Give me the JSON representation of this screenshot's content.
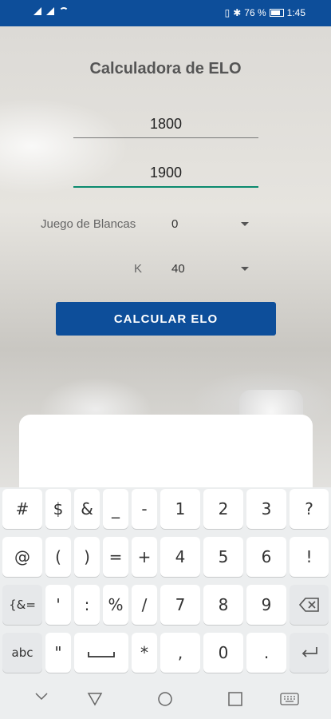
{
  "status_bar": {
    "battery_percent": "76 %",
    "time": "1:45"
  },
  "app": {
    "title": "Calculadora de ELO",
    "rating1": "1800",
    "rating2": "1900",
    "white_game_label": "Juego de Blancas",
    "white_game_value": "0",
    "k_label": "K",
    "k_value": "40",
    "calculate_button": "CALCULAR ELO"
  },
  "keyboard": {
    "row1": [
      "#",
      "$",
      "&",
      "_",
      "-",
      "1",
      "2",
      "3",
      "?"
    ],
    "row2": [
      "@",
      "(",
      ")",
      "=",
      "+",
      "4",
      "5",
      "6",
      "!"
    ],
    "row3": [
      "{&=",
      "'",
      ":",
      "%",
      "/",
      "7",
      "8",
      "9"
    ],
    "row4": [
      "abc",
      "\"",
      "*",
      ",",
      "0",
      "."
    ],
    "backspace_icon": "backspace-icon",
    "enter_icon": "enter-icon",
    "space_icon": "space-icon"
  },
  "navigation": {
    "icons": [
      "hide-keyboard-icon",
      "back-icon",
      "home-icon",
      "recents-icon",
      "keyboard-switch-icon"
    ]
  }
}
